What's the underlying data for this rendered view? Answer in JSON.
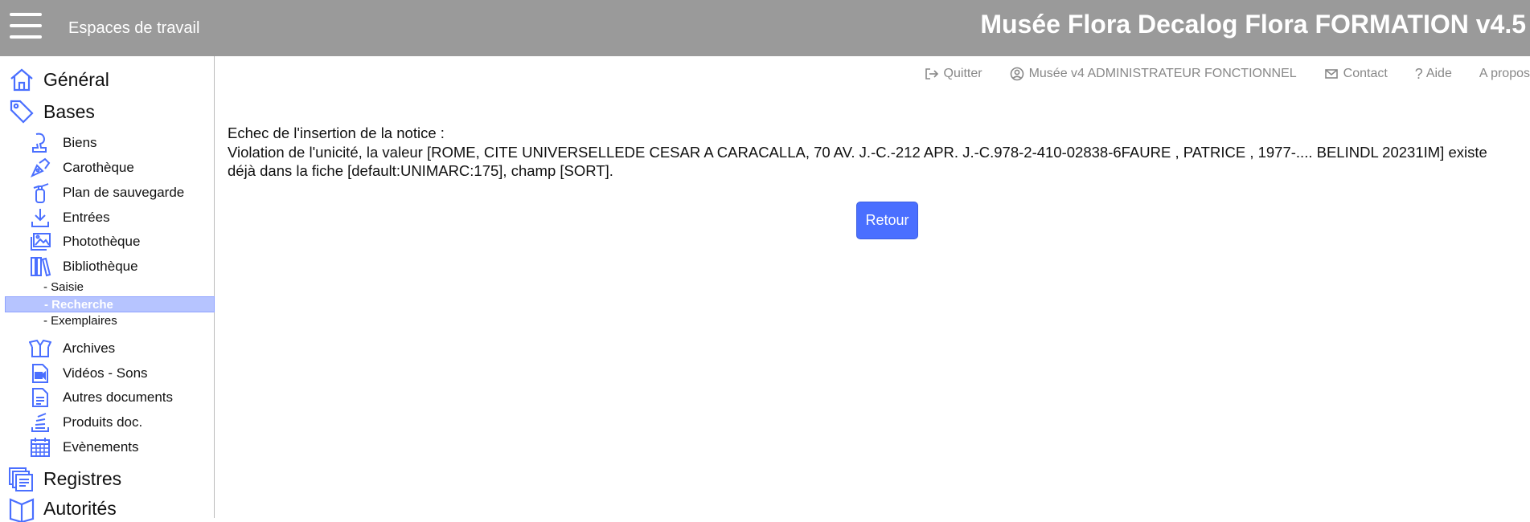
{
  "header": {
    "workspaces_label": "Espaces de travail",
    "app_title": "Musée Flora Decalog Flora FORMATION v4.5",
    "background_color": "#9a9a9a"
  },
  "utility": {
    "quit": "Quitter",
    "user": "Musée v4 ADMINISTRATEUR FONCTIONNEL",
    "contact": "Contact",
    "help": "Aide",
    "about": "A propos"
  },
  "sidebar": {
    "general": "Général",
    "bases": "Bases",
    "items": [
      {
        "label": "Biens",
        "icon": "bust-icon"
      },
      {
        "label": "Carothèque",
        "icon": "pen-nib-icon"
      },
      {
        "label": "Plan de sauvegarde",
        "icon": "fire-extinguisher-icon"
      },
      {
        "label": "Entrées",
        "icon": "download-icon"
      },
      {
        "label": "Photothèque",
        "icon": "images-icon"
      },
      {
        "label": "Bibliothèque",
        "icon": "books-icon"
      }
    ],
    "library_sub": [
      "- Saisie",
      "- Recherche",
      "- Exemplaires"
    ],
    "items2": [
      {
        "label": "Archives",
        "icon": "open-box-icon"
      },
      {
        "label": "Vidéos - Sons",
        "icon": "video-file-icon"
      },
      {
        "label": "Autres documents",
        "icon": "document-icon"
      },
      {
        "label": "Produits doc.",
        "icon": "stack-icon"
      },
      {
        "label": "Evènements",
        "icon": "calendar-icon"
      }
    ],
    "registres": "Registres",
    "autorites": "Autorités",
    "accent_color": "#4a6fff",
    "active_color": "#b6c4ff"
  },
  "main": {
    "error_title": "Echec de l'insertion de la notice :",
    "error_detail": "Violation de l'unicité, la valeur [ROME, CITE UNIVERSELLEDE CESAR A CARACALLA, 70 AV. J.-C.-212 APR. J.-C.978-2-410-02838-6FAURE , PATRICE , 1977-.... BELINDL 20231IM] existe déjà dans la fiche [default:UNIMARC:175], champ [SORT].",
    "back_button": "Retour"
  }
}
